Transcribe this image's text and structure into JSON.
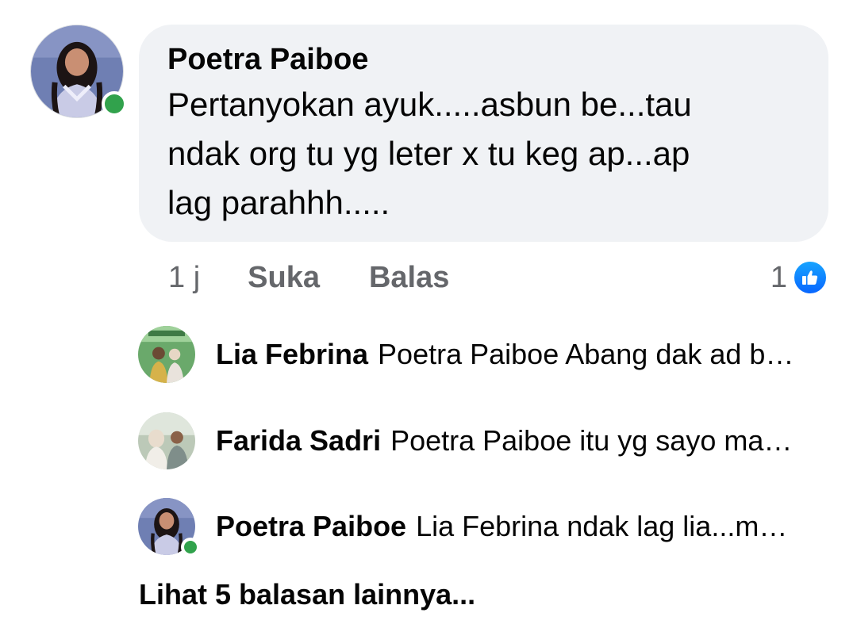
{
  "comment": {
    "author": "Poetra Paiboe",
    "text": "Pertanyokan ayuk.....asbun be...tau\nndak org tu yg leter x tu keg ap...ap\nlag parahhh.....",
    "time": "1 j",
    "like_label": "Suka",
    "reply_label": "Balas",
    "reaction_count": "1",
    "reaction_icon": "like-icon",
    "author_online": true
  },
  "replies": [
    {
      "name": "Lia Febrina",
      "text": "Poetra Paiboe Abang dak ad b…",
      "online": false
    },
    {
      "name": "Farida Sadri",
      "text": "Poetra Paiboe itu yg sayo ma…",
      "online": false
    },
    {
      "name": "Poetra Paiboe",
      "text": "Lia Febrina ndak lag lia...m…",
      "online": true
    }
  ],
  "more_replies_label": "Lihat 5 balasan lainnya...",
  "colors": {
    "bubble_bg": "#f0f2f5",
    "secondary_text": "#65676b",
    "online_green": "#31a24c",
    "like_blue": "#0866ff"
  }
}
